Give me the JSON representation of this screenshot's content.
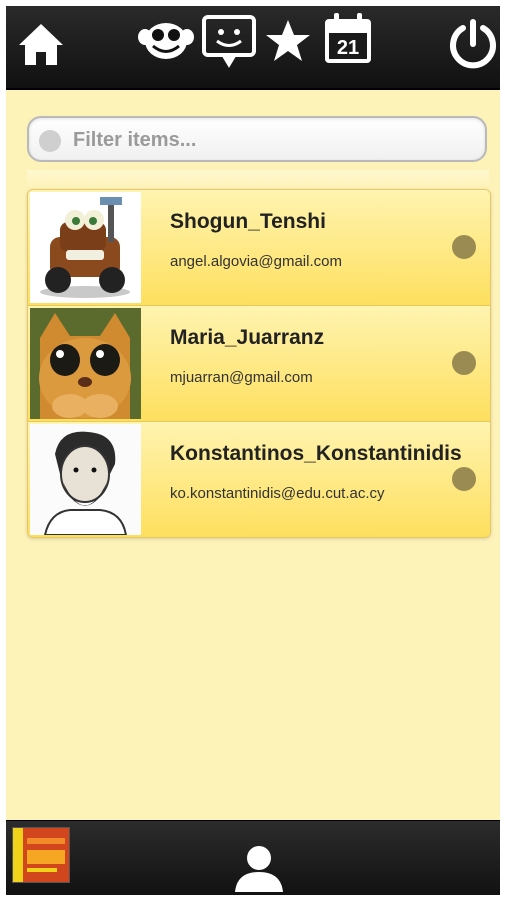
{
  "header": {
    "icons": [
      "home-icon",
      "monkey-face-icon",
      "chat-smile-icon",
      "star-icon",
      "calendar-icon",
      "power-icon"
    ],
    "calendar_day": "21"
  },
  "filter": {
    "placeholder": "Filter items..."
  },
  "contacts": [
    {
      "name": "Shogun_Tenshi",
      "email": "angel.algovia@gmail.com",
      "avatar": "tow-truck-cartoon-avatar",
      "status_color": "#9a8b52"
    },
    {
      "name": "Maria_Juarranz",
      "email": "mjuarran@gmail.com",
      "avatar": "orange-cat-avatar",
      "status_color": "#9a8b52"
    },
    {
      "name": "Konstantinos_Konstantinidis",
      "email": "ko.konstantinidis@edu.cut.ac.cy",
      "avatar": "bearded-man-sketch-avatar",
      "status_color": "#9a8b52"
    }
  ],
  "footer": {
    "icons": [
      "app-logo",
      "profile-icon"
    ]
  },
  "colors": {
    "bar": "#1a1a1a",
    "background": "#fdf2b8",
    "row_gradient_top": "#fff4b0",
    "row_gradient_bottom": "#fddf5e",
    "status": "#9a8b52"
  }
}
